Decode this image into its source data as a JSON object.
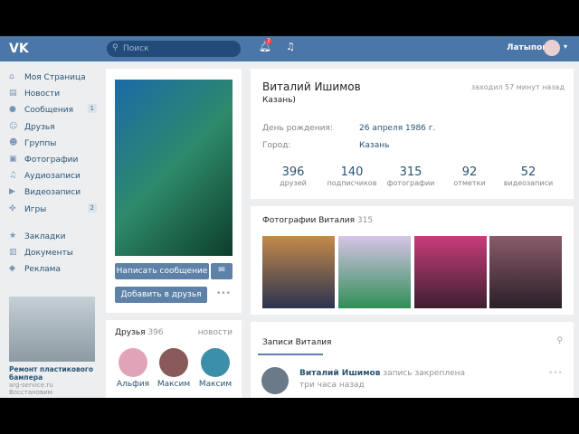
{
  "topbar": {
    "search_placeholder": "Поиск",
    "notif_count": "7",
    "user": "Латыпов"
  },
  "sidebar": [
    {
      "label": "Моя Страница",
      "icon": "⌂"
    },
    {
      "label": "Новости",
      "icon": "▤"
    },
    {
      "label": "Сообщения",
      "icon": "●",
      "count": "1"
    },
    {
      "label": "Друзья",
      "icon": "☺"
    },
    {
      "label": "Группы",
      "icon": "☻"
    },
    {
      "label": "Фотографии",
      "icon": "▣"
    },
    {
      "label": "Аудиозаписи",
      "icon": "♫"
    },
    {
      "label": "Видеозаписи",
      "icon": "▶"
    },
    {
      "label": "Игры",
      "icon": "✜",
      "count": "2"
    },
    {
      "label": "Закладки",
      "icon": "★"
    },
    {
      "label": "Документы",
      "icon": "▥"
    },
    {
      "label": "Реклама",
      "icon": "◆"
    }
  ],
  "ad": {
    "title": "Ремонт пластикового бампера",
    "url": "arg-service.ru",
    "cut": "Восстановим"
  },
  "profile": {
    "name": "Виталий Ишимов",
    "status": "Казань)",
    "last_seen": "заходил 57 минут назад",
    "birthday_label": "День рождения:",
    "birthday": "26 апреля 1986 г.",
    "city_label": "Город:",
    "city": "Казань",
    "write": "Написать сообщение",
    "add": "Добавить в друзья"
  },
  "stats": [
    {
      "n": "396",
      "l": "друзей"
    },
    {
      "n": "140",
      "l": "подписчиков"
    },
    {
      "n": "315",
      "l": "фотографии"
    },
    {
      "n": "92",
      "l": "отметки"
    },
    {
      "n": "52",
      "l": "видеозаписи"
    }
  ],
  "photos": {
    "title": "Фотографии Виталия",
    "count": "315"
  },
  "friends": {
    "title": "Друзья",
    "count": "396",
    "updates": "новости",
    "list": [
      "Альфия",
      "Максим",
      "Максим"
    ]
  },
  "wall": {
    "tab": "Записи Виталия",
    "author": "Виталий Ишимов",
    "pinned": "запись закреплена",
    "time": "три часа назад"
  }
}
